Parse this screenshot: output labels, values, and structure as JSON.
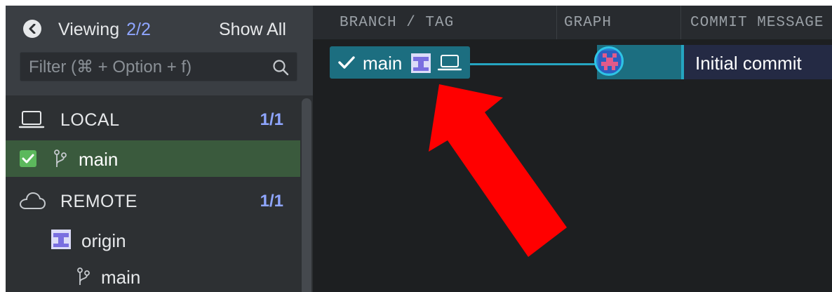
{
  "sidebar": {
    "viewing_label": "Viewing",
    "viewing_count": "2/2",
    "show_all": "Show All",
    "filter_placeholder": "Filter (⌘ + Option + f)",
    "local": {
      "label": "LOCAL",
      "count": "1/1",
      "branches": [
        {
          "name": "main",
          "checked": true
        }
      ]
    },
    "remote": {
      "label": "REMOTE",
      "count": "1/1",
      "remotes": [
        {
          "name": "origin",
          "branches": [
            "main"
          ]
        }
      ]
    }
  },
  "graph": {
    "columns": [
      "BRANCH / TAG",
      "GRAPH",
      "COMMIT MESSAGE"
    ],
    "rows": [
      {
        "branch": "main",
        "message": "Initial commit"
      }
    ]
  },
  "colors": {
    "sidebar_bg": "#2d3033",
    "selected_branch_bg": "#3a5a3d",
    "branch_pill": "#1c6e80",
    "connector": "#25a5c1",
    "count_accent": "#8fa6ff",
    "arrow": "#ff0000"
  },
  "icons": [
    "back-chevron-icon",
    "search-icon",
    "laptop-icon",
    "cloud-icon",
    "branch-icon",
    "checkbox-icon",
    "checkmark-icon",
    "avatar-icon",
    "red-arrow-annotation"
  ]
}
